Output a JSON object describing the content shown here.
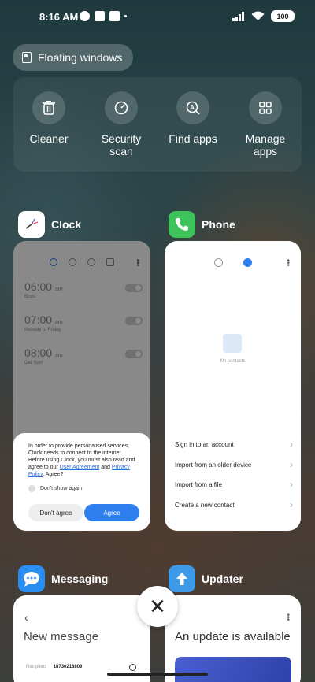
{
  "status": {
    "time": "8:16 AM",
    "battery": "100"
  },
  "floating": {
    "label": "Floating windows"
  },
  "tools": [
    {
      "label": "Cleaner",
      "icon": "trash-icon"
    },
    {
      "label": "Security scan",
      "icon": "shield-icon"
    },
    {
      "label": "Find apps",
      "icon": "search-apps-icon"
    },
    {
      "label": "Manage apps",
      "icon": "grid-icon"
    }
  ],
  "apps": {
    "clock": {
      "name": "Clock",
      "alarms": [
        {
          "time": "06:00",
          "ampm": "am",
          "sub": "Birds"
        },
        {
          "time": "07:00",
          "ampm": "am",
          "sub": "Monday to Friday"
        },
        {
          "time": "08:00",
          "ampm": "am",
          "sub": "Get Sun!"
        }
      ],
      "dialog": {
        "text_before": "In order to provide personalised services, Clock needs to connect to the internet. Before using Clock, you must also read and agree to our ",
        "link1": "User Agreement",
        "and": " and ",
        "link2": "Privacy Policy",
        "text_after": ". Agree?",
        "dont_show": "Don't show again",
        "disagree": "Don't agree",
        "agree": "Agree"
      }
    },
    "phone": {
      "name": "Phone",
      "no_contacts": "No contacts",
      "items": [
        "Sign in to an account",
        "Import from an older device",
        "Import from a file",
        "Create a new contact"
      ]
    },
    "messaging": {
      "name": "Messaging",
      "back": "‹",
      "title": "New message",
      "recipient_label": "Recipient:",
      "recipient_value": "18730218809"
    },
    "updater": {
      "name": "Updater",
      "title": "An update is available"
    }
  },
  "close": {
    "label": "✕"
  },
  "colors": {
    "accent": "#2f7ef0",
    "phone_green": "#3ec35a",
    "messaging_blue": "#2a8df0",
    "updater_blue": "#3d9ae8"
  }
}
